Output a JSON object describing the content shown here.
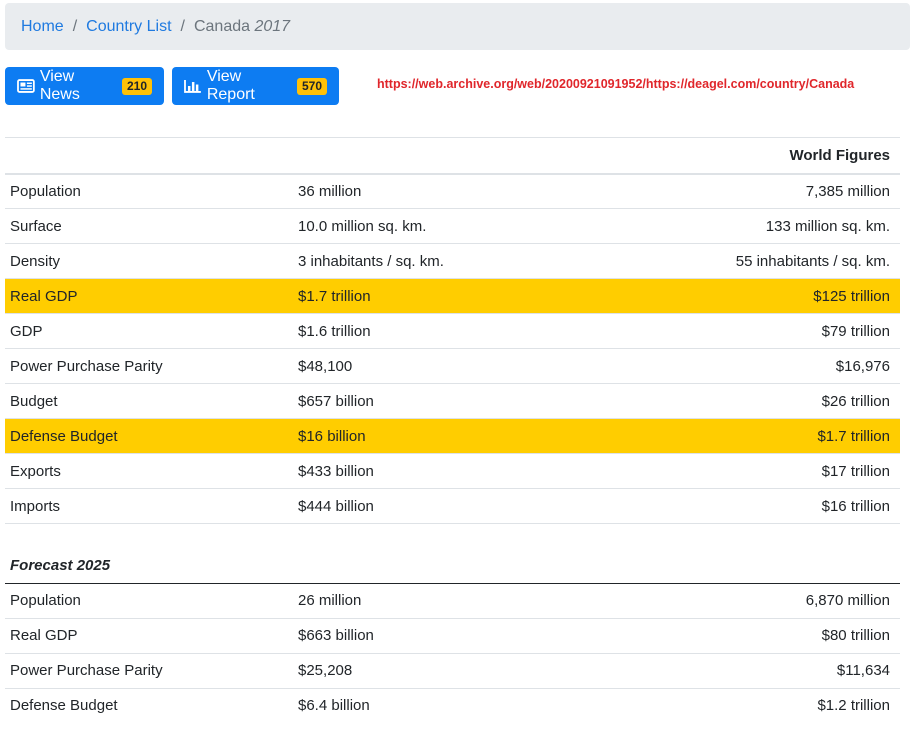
{
  "breadcrumb": {
    "home": "Home",
    "country_list": "Country List",
    "current": "Canada",
    "year": "2017"
  },
  "buttons": {
    "news": {
      "label": "View News",
      "badge": "210",
      "icon": "newspaper-icon"
    },
    "report": {
      "label": "View Report",
      "badge": "570",
      "icon": "bar-chart-icon"
    }
  },
  "archive_url": "https://web.archive.org/web/20200921091952/https://deagel.com/country/Canada",
  "colors": {
    "accent": "#0d7cf2",
    "badge": "#ffc107",
    "highlight": "#ffcd00",
    "link_red": "#e0262b"
  },
  "main_table": {
    "header": "World Figures",
    "rows": [
      {
        "label": "Population",
        "country": "36 million",
        "world": "7,385 million",
        "highlight": false
      },
      {
        "label": "Surface",
        "country": "10.0 million sq. km.",
        "world": "133 million sq. km.",
        "highlight": false
      },
      {
        "label": "Density",
        "country": "3 inhabitants / sq. km.",
        "world": "55 inhabitants / sq. km.",
        "highlight": false
      },
      {
        "label": "Real GDP",
        "country": "$1.7 trillion",
        "world": "$125 trillion",
        "highlight": true
      },
      {
        "label": "GDP",
        "country": "$1.6 trillion",
        "world": "$79 trillion",
        "highlight": false
      },
      {
        "label": "Power Purchase Parity",
        "country": "$48,100",
        "world": "$16,976",
        "highlight": false
      },
      {
        "label": "Budget",
        "country": "$657 billion",
        "world": "$26 trillion",
        "highlight": false
      },
      {
        "label": "Defense Budget",
        "country": "$16 billion",
        "world": "$1.7 trillion",
        "highlight": true
      },
      {
        "label": "Exports",
        "country": "$433 billion",
        "world": "$17 trillion",
        "highlight": false
      },
      {
        "label": "Imports",
        "country": "$444 billion",
        "world": "$16 trillion",
        "highlight": false
      }
    ]
  },
  "forecast_table": {
    "header": "Forecast 2025",
    "rows": [
      {
        "label": "Population",
        "country": "26 million",
        "world": "6,870 million"
      },
      {
        "label": "Real GDP",
        "country": "$663 billion",
        "world": "$80 trillion"
      },
      {
        "label": "Power Purchase Parity",
        "country": "$25,208",
        "world": "$11,634"
      },
      {
        "label": "Defense Budget",
        "country": "$6.4 billion",
        "world": "$1.2 trillion"
      }
    ]
  }
}
